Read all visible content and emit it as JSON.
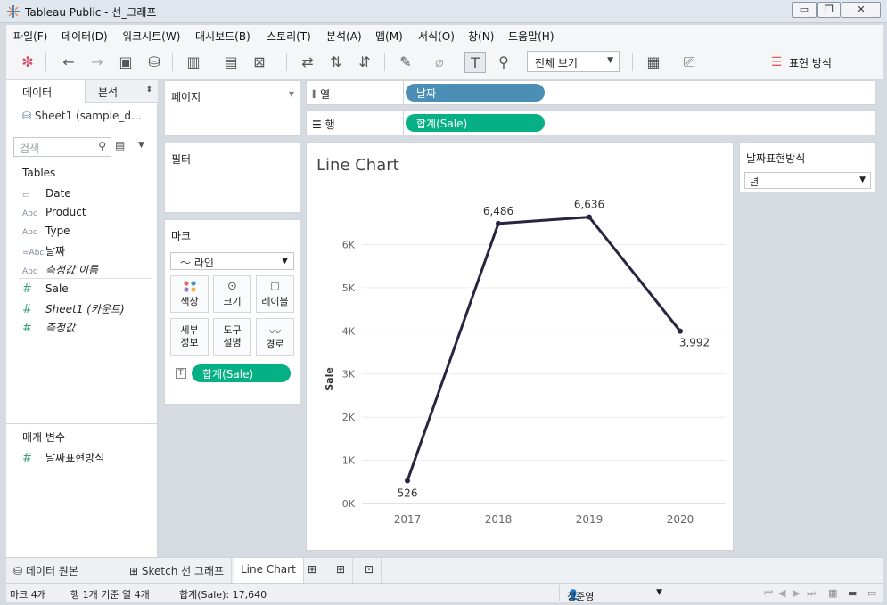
{
  "window": {
    "title": "Tableau Public - 선_그래프",
    "minimize": "▭",
    "restore": "❐",
    "close": "✕"
  },
  "menu": [
    "파일(F)",
    "데이터(D)",
    "워크시트(W)",
    "대시보드(B)",
    "스토리(T)",
    "분석(A)",
    "맵(M)",
    "서식(O)",
    "창(N)",
    "도움말(H)"
  ],
  "toolbar": {
    "view_mode": "전체 보기",
    "show_me": "표현 방식"
  },
  "left_panel": {
    "tab_data": "데이터",
    "tab_analysis": "분석",
    "datasource": "Sheet1 (sample_d...",
    "search_placeholder": "검색",
    "tables_header": "Tables",
    "dimensions": [
      {
        "icon": "calendar",
        "glyph": "📅",
        "label": "Date"
      },
      {
        "icon": "Abc",
        "glyph": "Abc",
        "label": "Product"
      },
      {
        "icon": "Abc",
        "glyph": "Abc",
        "label": "Type"
      },
      {
        "icon": "=Abc",
        "glyph": "=Abc",
        "label": "날짜"
      },
      {
        "icon": "Abc",
        "glyph": "Abc",
        "label": "측정값 이름"
      }
    ],
    "measures": [
      {
        "glyph": "#",
        "label": "Sale"
      },
      {
        "glyph": "#",
        "label": "Sheet1 (카운트)"
      },
      {
        "glyph": "#",
        "label": "측정값"
      }
    ],
    "params_header": "매개 변수",
    "params": [
      {
        "glyph": "#",
        "label": "날짜표현방식"
      }
    ]
  },
  "cards": {
    "pages": "페이지",
    "filters": "필터",
    "marks": "마크",
    "mark_type": "라인",
    "mark_buttons": [
      {
        "icon": "color-dots",
        "glyph": "⁘",
        "label": "색상"
      },
      {
        "icon": "size",
        "glyph": "◌",
        "label": "크기"
      },
      {
        "icon": "label-T",
        "glyph": "🅃",
        "label": "레이블"
      },
      {
        "icon": "detail",
        "glyph": "",
        "label": "세부\n정보"
      },
      {
        "icon": "tooltip",
        "glyph": "",
        "label": "도구\n설명"
      },
      {
        "icon": "path",
        "glyph": "〰",
        "label": "경로"
      }
    ],
    "label_pill": "합계(Sale)"
  },
  "shelves": {
    "columns_label": "열",
    "columns_pill": "날짜",
    "rows_label": "행",
    "rows_pill": "합계(Sale)"
  },
  "parameter_card": {
    "title": "날짜표현방식",
    "value": "년"
  },
  "chart_data": {
    "type": "line",
    "title": "Line Chart",
    "xlabel": "",
    "ylabel": "Sale",
    "categories": [
      "2017",
      "2018",
      "2019",
      "2020"
    ],
    "values": [
      526,
      6486,
      6636,
      3992
    ],
    "data_labels": [
      "526",
      "6,486",
      "6,636",
      "3,992"
    ],
    "yticks": [
      0,
      1000,
      2000,
      3000,
      4000,
      5000,
      6000
    ],
    "ytick_labels": [
      "0K",
      "1K",
      "2K",
      "3K",
      "4K",
      "5K",
      "6K"
    ],
    "ylim": [
      0,
      7000
    ],
    "line_color": "#2a2440",
    "grid": true
  },
  "sheet_tabs": {
    "data_source": "데이터 원본",
    "sketch": "Sketch 선 그래프",
    "active": "Line Chart"
  },
  "status": {
    "marks": "마크 4개",
    "rows_cols": "행 1개 기준 열 4개",
    "sum": "합계(Sale): 17,640",
    "user": "정준영"
  }
}
